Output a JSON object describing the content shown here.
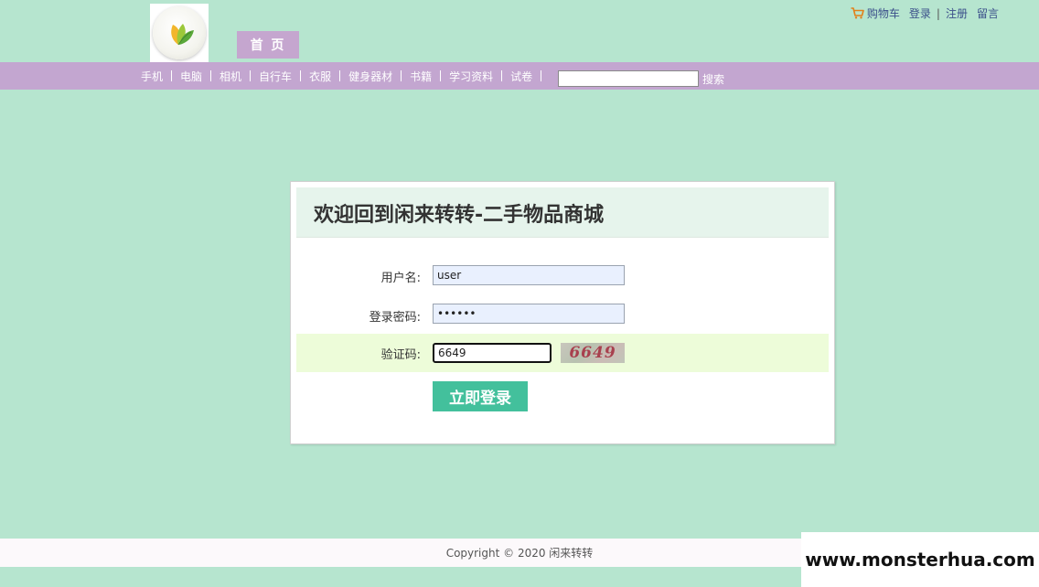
{
  "header": {
    "home_tab": "首 页",
    "top_links": {
      "cart": "购物车",
      "login": "登录",
      "separator": "|",
      "register": "注册",
      "message": "留言"
    }
  },
  "navbar": {
    "items": [
      "手机",
      "电脑",
      "相机",
      "自行车",
      "衣服",
      "健身器材",
      "书籍",
      "学习资料",
      "试卷"
    ],
    "search_button": "搜索",
    "search_value": ""
  },
  "login": {
    "title": "欢迎回到闲来转转-二手物品商城",
    "username_label": "用户名:",
    "username_value": "user",
    "password_label": "登录密码:",
    "password_value": "••••••",
    "captcha_label": "验证码:",
    "captcha_value": "6649",
    "captcha_image_text": "6649",
    "submit_label": "立即登录"
  },
  "footer": {
    "copyright": "Copyright © 2020 闲来转转"
  },
  "watermark": "www.monsterhua.com",
  "colors": {
    "page_background": "#b6e5cf",
    "navbar": "#c3a6d0",
    "home_tab": "#c5a6cf",
    "login_button": "#43c09c",
    "captcha_row": "#edfcd9",
    "title_bar": "#e6f4ec"
  },
  "icons": {
    "logo": "leaf-logo-icon",
    "cart": "shopping-cart-icon"
  }
}
